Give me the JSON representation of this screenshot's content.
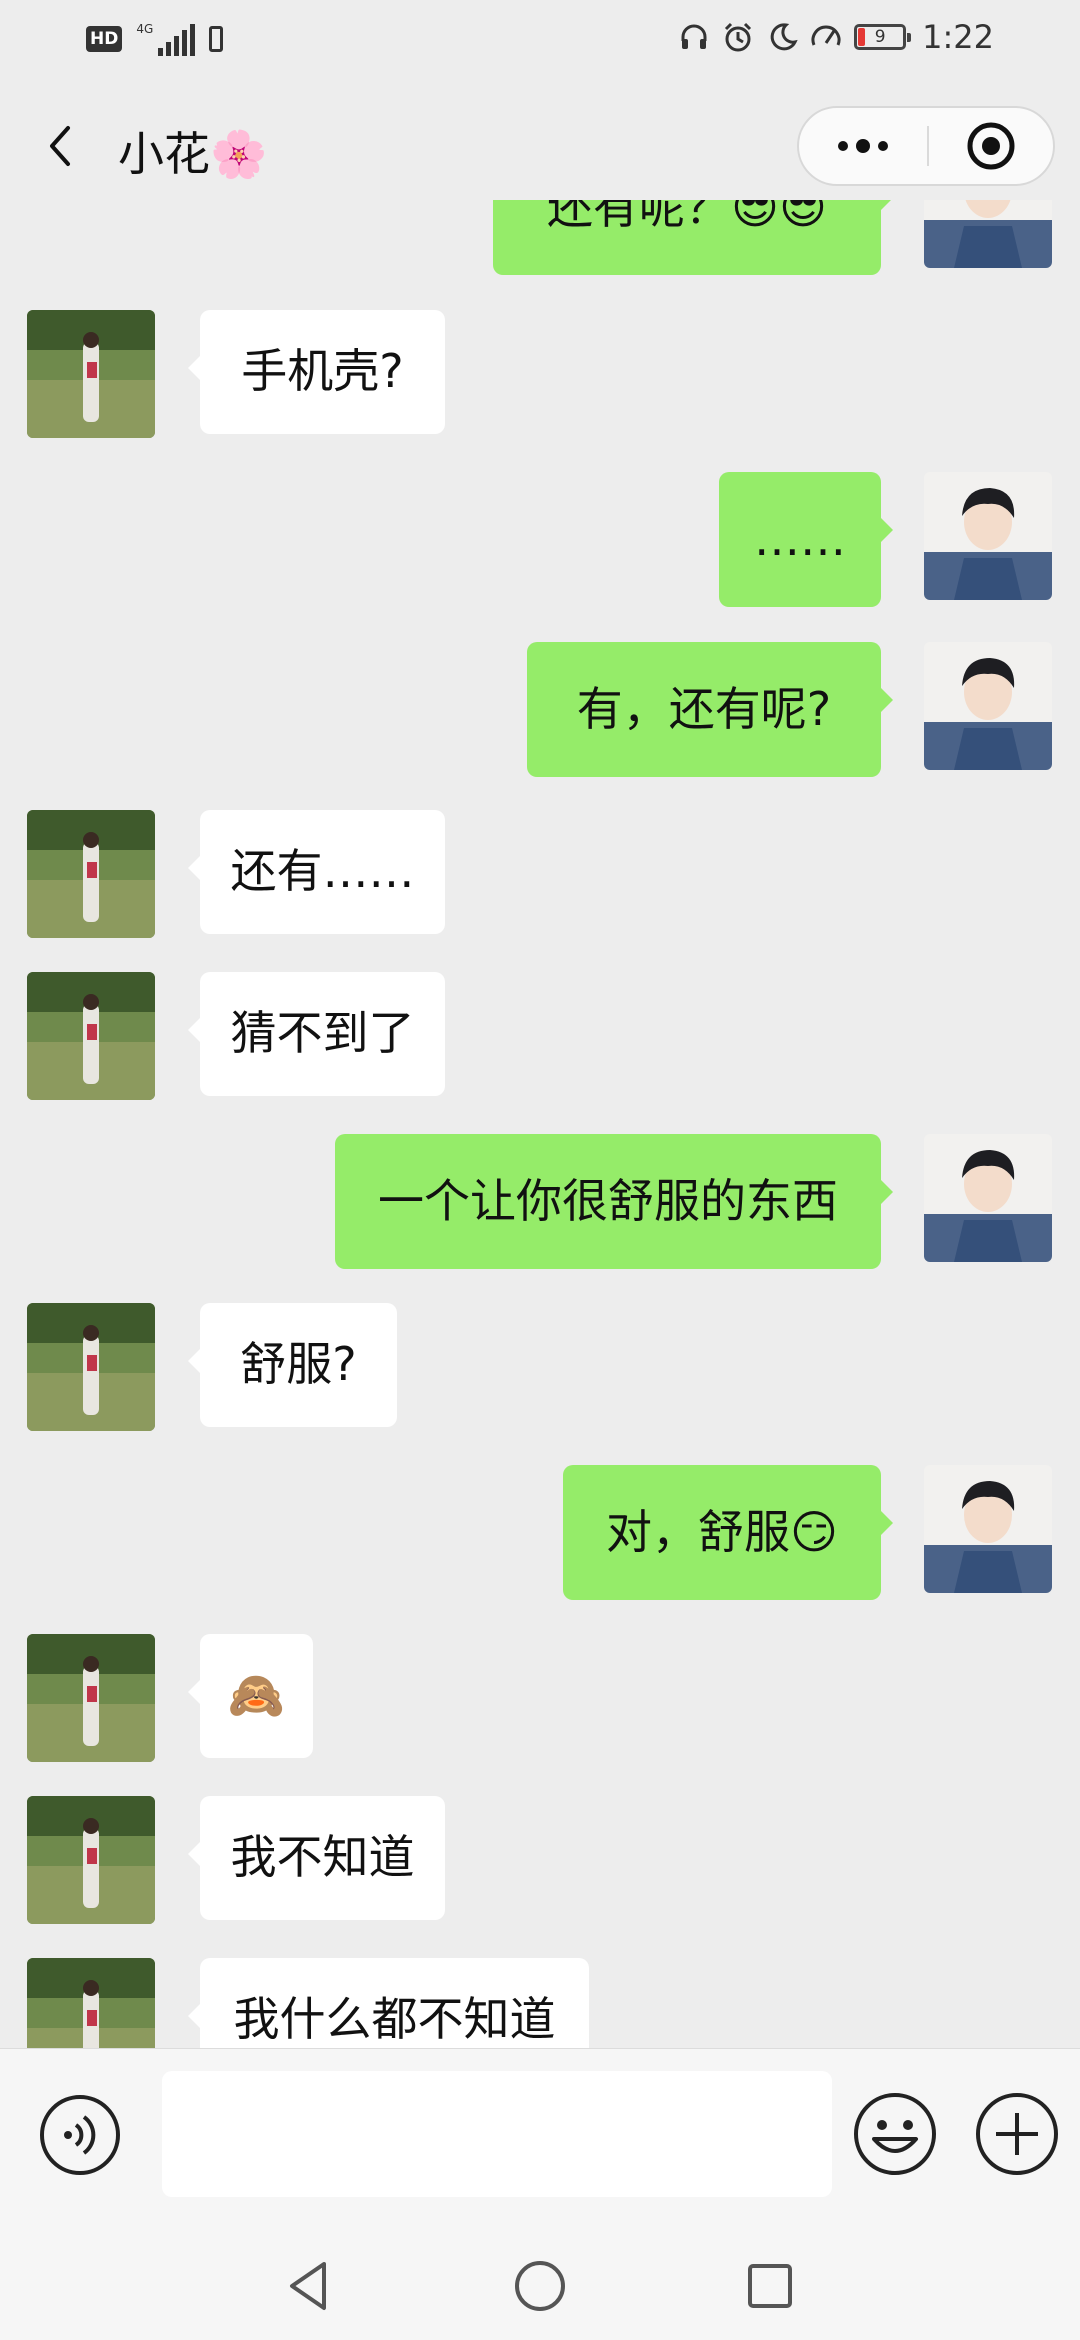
{
  "status_bar": {
    "hd_label": "HD",
    "network": "4G",
    "battery_level": "9",
    "time": "1:22",
    "battery_color": "#e53935"
  },
  "header": {
    "back_icon": "chevron-left-icon",
    "title": "小花🌸",
    "more_icon": "more-dots-icon",
    "close_icon": "target-circle-icon"
  },
  "messages": [
    {
      "side": "out",
      "text": "还有呢？😎😎",
      "partial": true
    },
    {
      "side": "in",
      "text": "手机壳?"
    },
    {
      "side": "out",
      "text": "……"
    },
    {
      "side": "out",
      "text": "有，还有呢?"
    },
    {
      "side": "in",
      "text": "还有……"
    },
    {
      "side": "in",
      "text": "猜不到了"
    },
    {
      "side": "out",
      "text": "一个让你很舒服的东西"
    },
    {
      "side": "in",
      "text": "舒服?"
    },
    {
      "side": "out",
      "text": "对，舒服😏"
    },
    {
      "side": "in",
      "text": "🙈"
    },
    {
      "side": "in",
      "text": "我不知道"
    },
    {
      "side": "in",
      "text": "我什么都不知道",
      "partial": true
    }
  ],
  "input_bar": {
    "voice_icon": "voice-icon",
    "input_value": "",
    "emoji_icon": "smiley-icon",
    "plus_icon": "plus-circle-icon"
  },
  "nav_bar": {
    "back_icon": "nav-back-icon",
    "home_icon": "nav-home-icon",
    "recents_icon": "nav-recents-icon"
  },
  "colors": {
    "background": "#ededed",
    "outgoing_bubble": "#95ec69",
    "incoming_bubble": "#ffffff"
  }
}
